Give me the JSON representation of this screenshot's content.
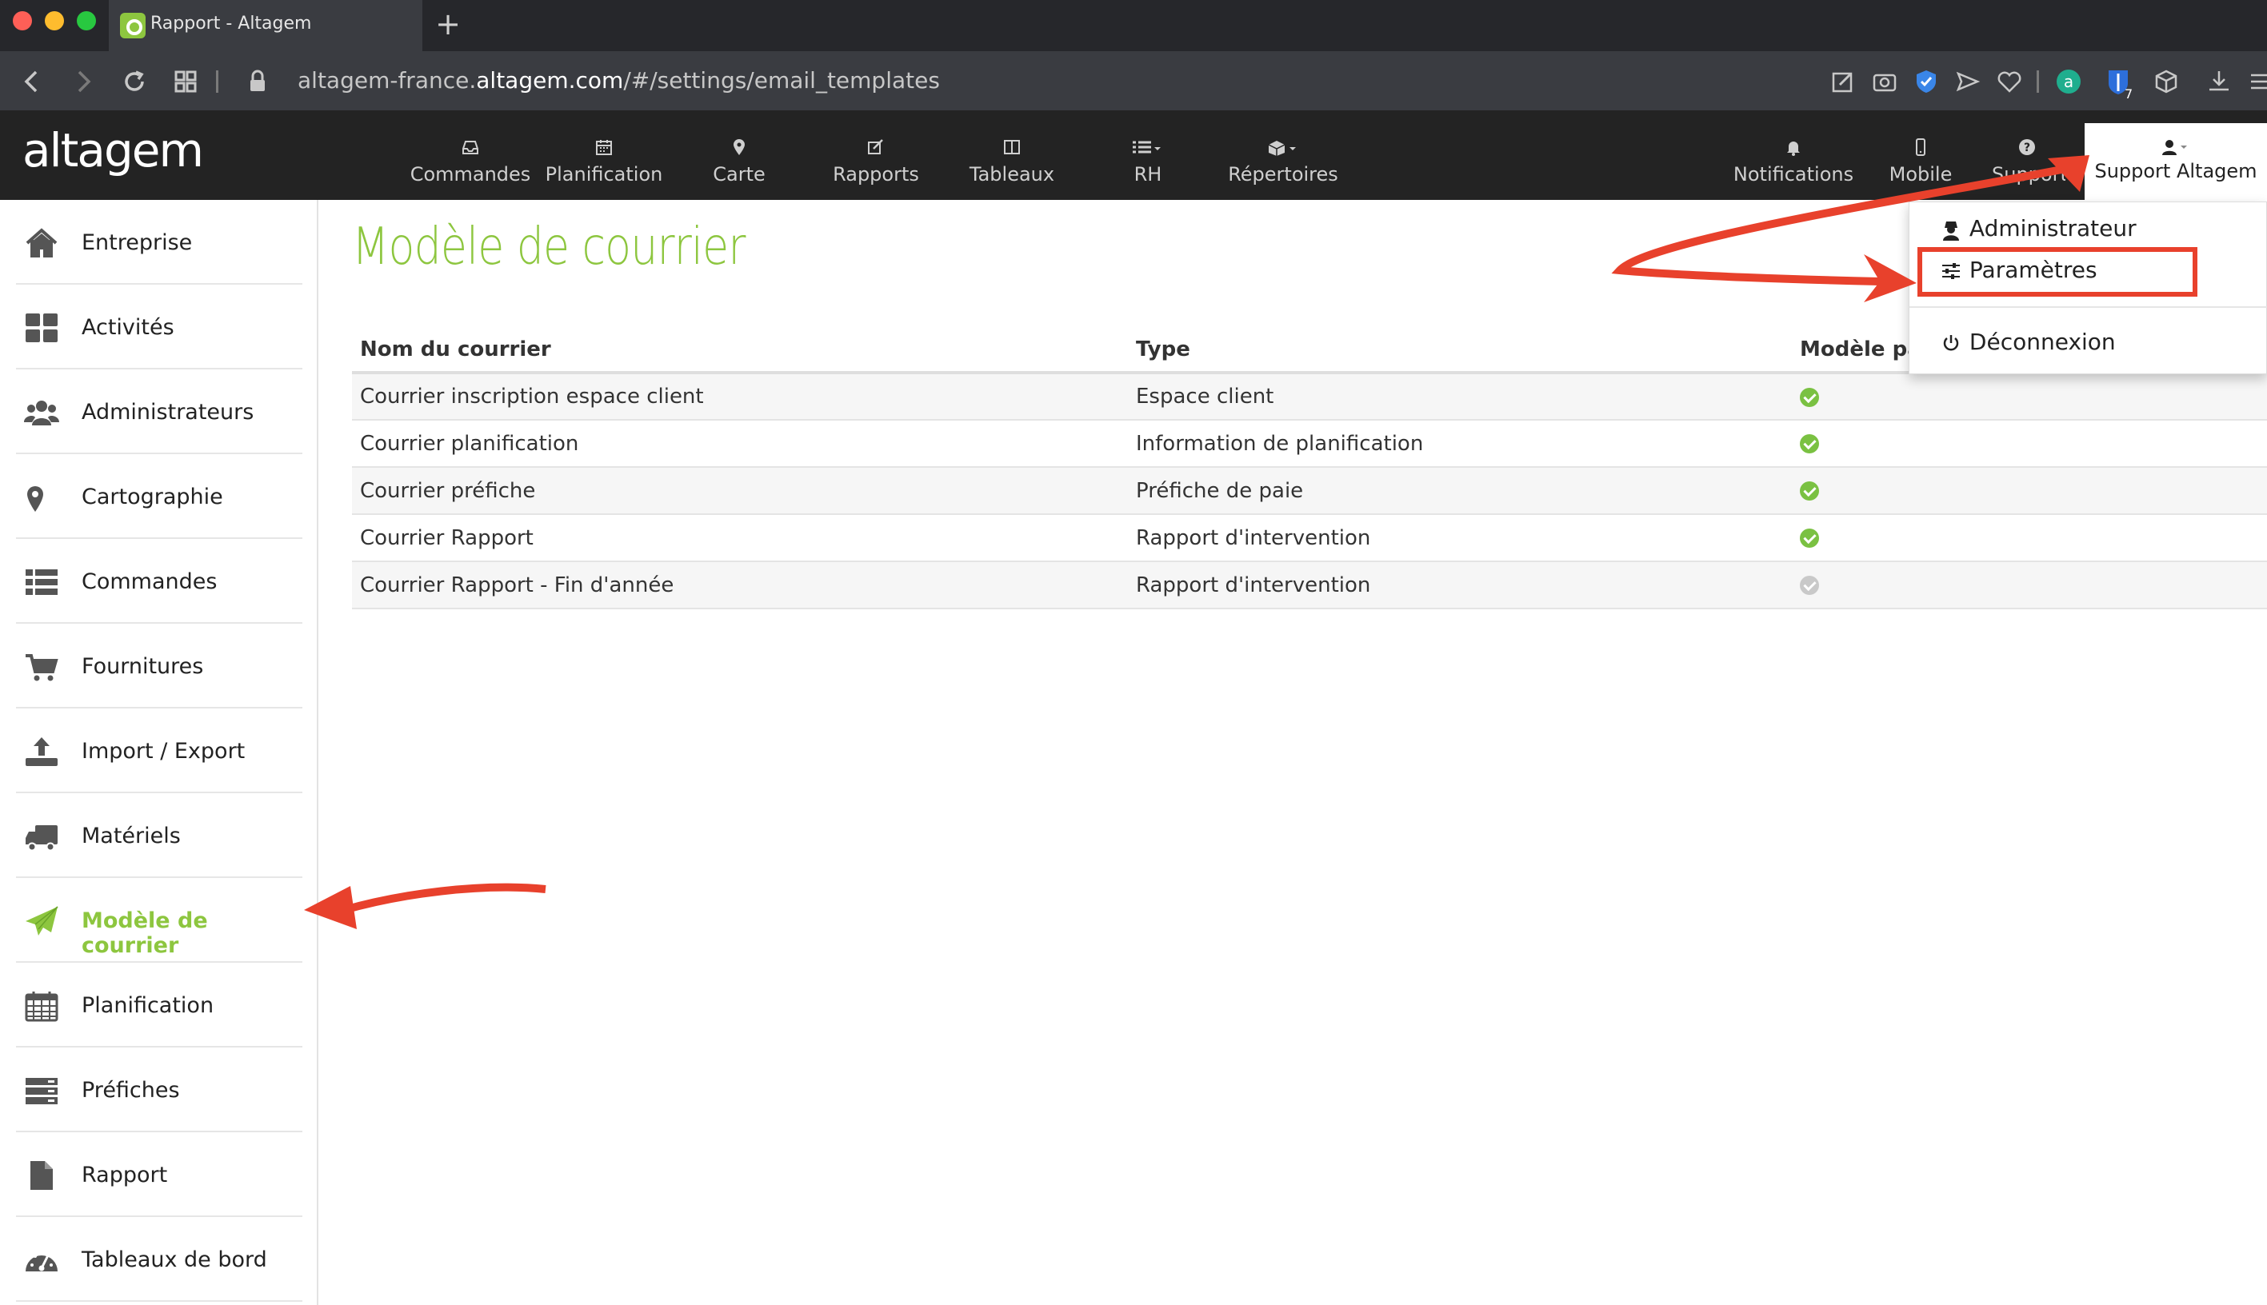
{
  "browser": {
    "tab_title": "Rapport - Altagem",
    "url_prefix": "altagem-france.",
    "url_domain": "altagem.com",
    "url_path": "/#/settings/email_templates",
    "extension_badge": "7"
  },
  "app": {
    "logo": "altagem",
    "nav": [
      {
        "label": "Commandes",
        "icon": "inbox-icon"
      },
      {
        "label": "Planification",
        "icon": "calendar-icon"
      },
      {
        "label": "Carte",
        "icon": "map-marker-icon"
      },
      {
        "label": "Rapports",
        "icon": "edit-icon"
      },
      {
        "label": "Tableaux",
        "icon": "columns-icon"
      },
      {
        "label": "RH",
        "icon": "list-dropdown-icon"
      },
      {
        "label": "Répertoires",
        "icon": "cubes-dropdown-icon"
      }
    ],
    "right_nav": [
      {
        "label": "Notifications",
        "icon": "bell-icon"
      },
      {
        "label": "Mobile",
        "icon": "mobile-icon"
      },
      {
        "label": "Support",
        "icon": "question-icon"
      }
    ],
    "user_label": "Support Altagem"
  },
  "dropdown": {
    "items": [
      "Administrateur",
      "Paramètres",
      "Déconnexion"
    ]
  },
  "sidebar": {
    "items": [
      {
        "label": "Entreprise",
        "icon": "home-icon"
      },
      {
        "label": "Activités",
        "icon": "th-large-icon"
      },
      {
        "label": "Administrateurs",
        "icon": "users-icon"
      },
      {
        "label": "Cartographie",
        "icon": "map-marker-icon"
      },
      {
        "label": "Commandes",
        "icon": "list-icon"
      },
      {
        "label": "Fournitures",
        "icon": "cart-icon"
      },
      {
        "label": "Import / Export",
        "icon": "upload-icon"
      },
      {
        "label": "Matériels",
        "icon": "truck-icon"
      },
      {
        "label": "Modèle de courrier",
        "icon": "paper-plane-icon",
        "active": true
      },
      {
        "label": "Planification",
        "icon": "calendar-icon"
      },
      {
        "label": "Préfiches",
        "icon": "server-icon"
      },
      {
        "label": "Rapport",
        "icon": "file-icon"
      },
      {
        "label": "Tableaux de bord",
        "icon": "dashboard-icon"
      }
    ]
  },
  "main": {
    "title": "Modèle de courrier",
    "columns": [
      "Nom du courrier",
      "Type",
      "Modèle pa"
    ],
    "rows": [
      {
        "name": "Courrier inscription espace client",
        "type": "Espace client",
        "default": true
      },
      {
        "name": "Courrier planification",
        "type": "Information de planification",
        "default": true
      },
      {
        "name": "Courrier préfiche",
        "type": "Préfiche de paie",
        "default": true
      },
      {
        "name": "Courrier Rapport",
        "type": "Rapport d'intervention",
        "default": true
      },
      {
        "name": "Courrier Rapport - Fin d'année",
        "type": "Rapport d'intervention",
        "default": false
      }
    ]
  },
  "colors": {
    "accent": "#8dc63f",
    "header_bg": "#232323",
    "annotation": "#e8412c",
    "check_on": "#7ac142",
    "check_off": "#c9c9c9"
  }
}
